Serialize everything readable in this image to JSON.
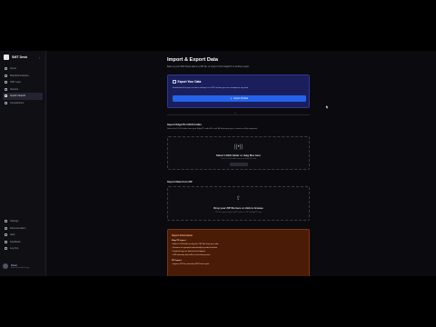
{
  "app": {
    "name": "SMT Desk"
  },
  "sidebar": {
    "items": [
      {
        "label": "Home",
        "icon": "home-icon"
      },
      {
        "label": "Manifold Analytics",
        "icon": "chart-icon"
      },
      {
        "label": "SMT Laps",
        "icon": "list-icon"
      },
      {
        "label": "Session",
        "icon": "clock-icon"
      },
      {
        "label": "Import / Export",
        "icon": "swap-icon"
      },
      {
        "label": "Comparisons",
        "icon": "compare-icon"
      }
    ],
    "active_index": 4,
    "bottom_items": [
      {
        "label": "Settings",
        "icon": "gear-icon"
      },
      {
        "label": "Documentation",
        "icon": "book-icon"
      },
      {
        "label": "Help",
        "icon": "help-icon"
      },
      {
        "label": "Feedback",
        "icon": "chat-icon"
      },
      {
        "label": "Log Out",
        "icon": "logout-icon"
      }
    ],
    "user": {
      "name": "Driver",
      "email": "driver@smtdesk.app"
    }
  },
  "page": {
    "title": "Import & Export Data",
    "subtitle": "Back up your SMT Desk data to a ZIP file, or import it from EdgeTX or another export."
  },
  "export": {
    "title": "Export Your Data",
    "description": "Download all of your sessions and laps as a ZIP archive you can re-import at any time.",
    "button_label": "Export All Data"
  },
  "divider_label": "or",
  "import_folder": {
    "title": "Import EdgeTX LOGS Folder",
    "description": "Select the LOGS folder from your EdgeTX radio SD card. All telemetry logs it contains will be imported.",
    "drop_main": "Select LOGS folder or drag files here",
    "drop_sub": "Select LOGS folder from your EdgeTX radio"
  },
  "import_zip": {
    "title": "Import Data from ZIP",
    "drop_main": "Drop your ZIP file here or click to browse",
    "drop_sub": "ZIP file exported from SMT Desk or a ZIP of EdgeTX logs"
  },
  "info": {
    "title": "Import Information",
    "sections": [
      {
        "heading": "EdgeTX Import",
        "items": [
          "Select LOGS folder or drag the CSV files from your radio",
          "Sessions are grouped automatically by model and date",
          "Duplicate logs are detected and skipped",
          "GPS telemetry data will be used when present"
        ]
      },
      {
        "heading": "ZIP Import",
        "items": [
          "Import a ZIP file created by SMT Desk export"
        ]
      }
    ]
  },
  "colors": {
    "accent": "#2563eb",
    "export_card": "#1a1f5c",
    "info_card": "#4a1c08"
  }
}
